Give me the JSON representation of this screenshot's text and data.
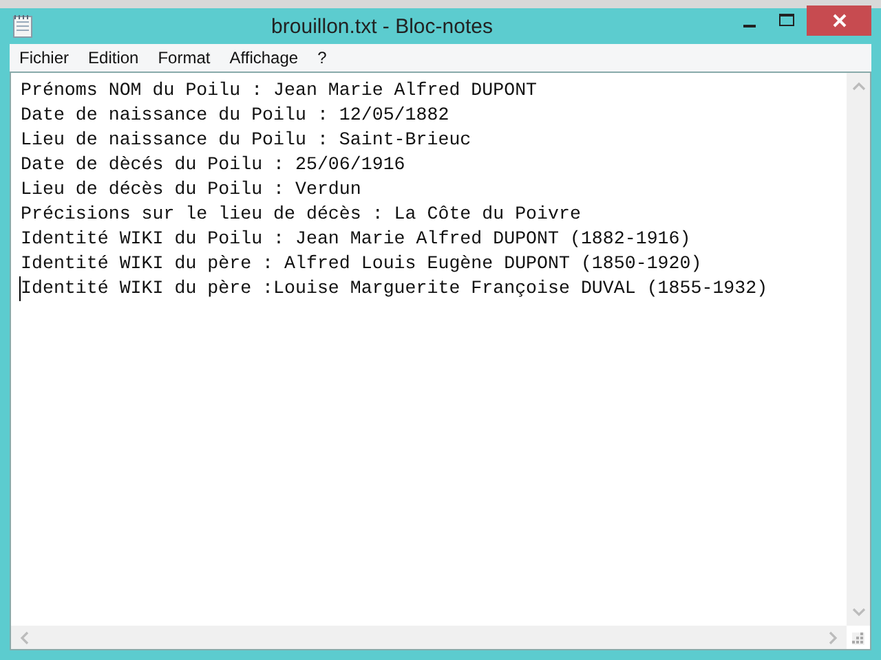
{
  "window": {
    "title": "brouillon.txt - Bloc-notes"
  },
  "menu": [
    "Fichier",
    "Edition",
    "Format",
    "Affichage",
    "?"
  ],
  "editor": {
    "lines": [
      "Prénoms NOM du Poilu : Jean Marie Alfred DUPONT",
      "Date de naissance du Poilu : 12/05/1882",
      "Lieu de naissance du Poilu : Saint-Brieuc",
      "Date de dècés du Poilu : 25/06/1916",
      "Lieu de décès du Poilu : Verdun",
      "Précisions sur le lieu de décès : La Côte du Poivre",
      "Identité WIKI du Poilu : Jean Marie Alfred DUPONT (1882-1916)",
      "Identité WIKI du père : Alfred Louis Eugène DUPONT (1850-1920)",
      "Identité WIKI du père :Louise Marguerite Françoise DUVAL (1855-1932)"
    ]
  }
}
